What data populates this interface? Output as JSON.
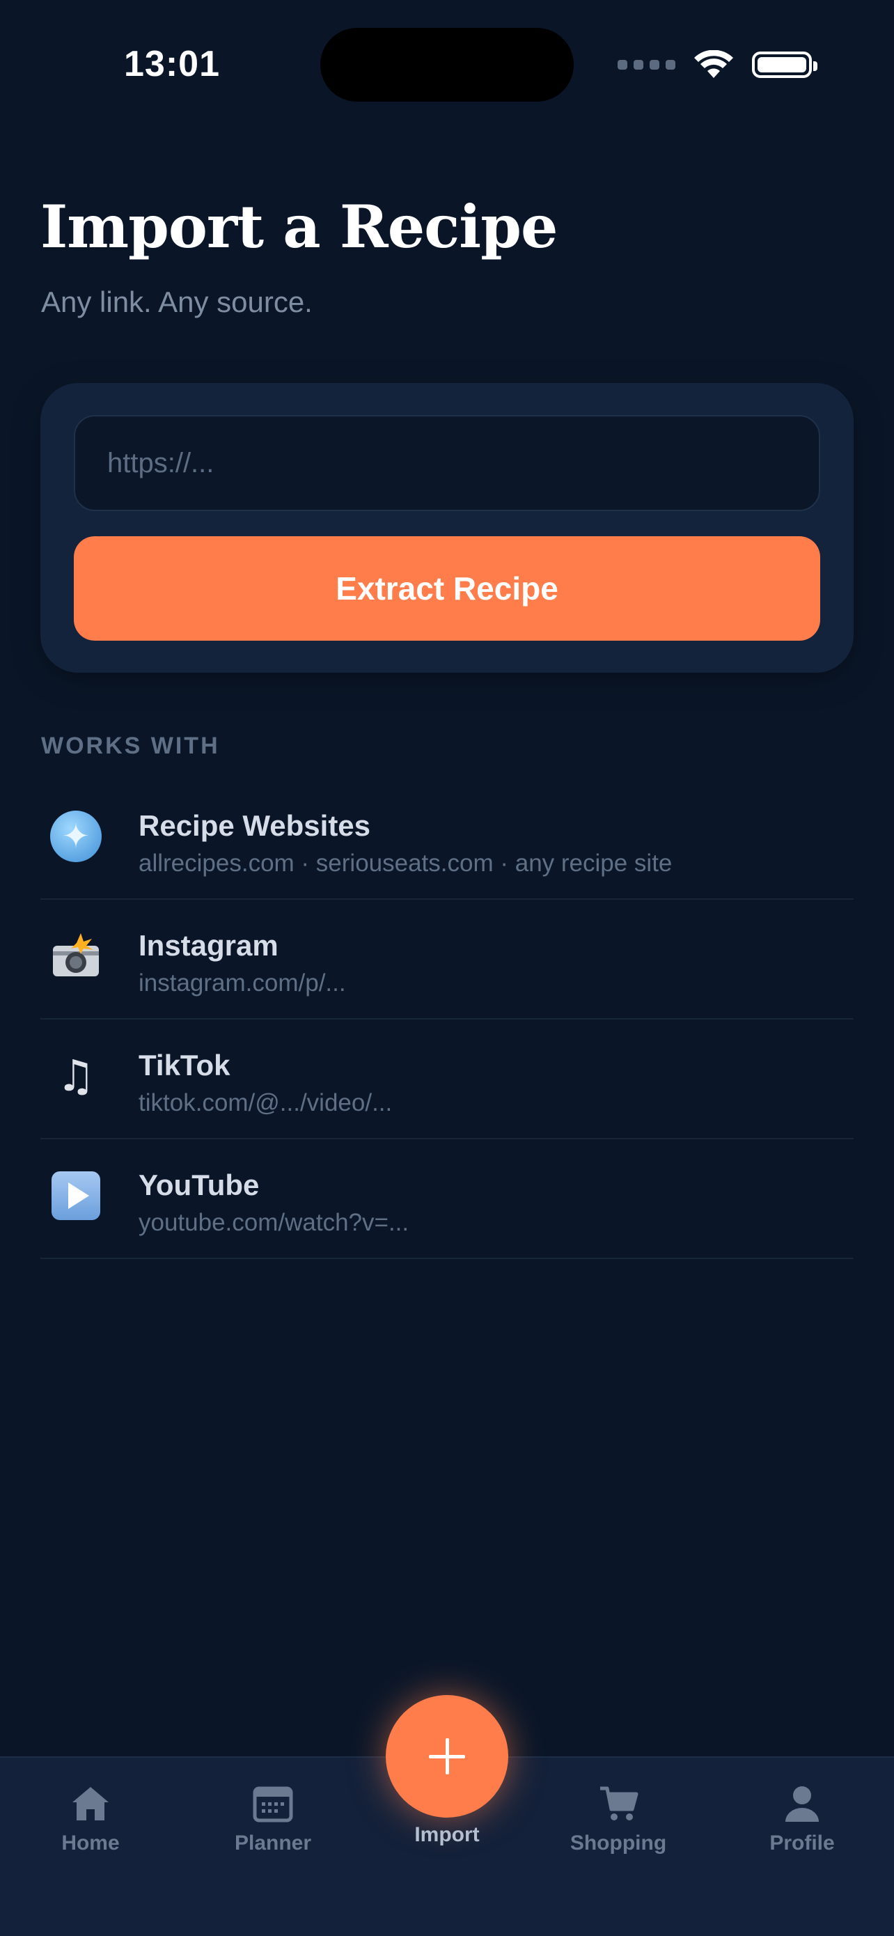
{
  "status_bar": {
    "time": "13:01"
  },
  "header": {
    "title": "Import a Recipe",
    "subtitle": "Any link. Any source."
  },
  "import_card": {
    "url_placeholder": "https://...",
    "url_value": "",
    "extract_label": "Extract Recipe"
  },
  "works_with": {
    "label": "WORKS WITH",
    "sources": [
      {
        "icon": "globe-icon",
        "name": "Recipe Websites",
        "desc": "allrecipes.com · seriouseats.com · any recipe site"
      },
      {
        "icon": "camera-flash-icon",
        "name": "Instagram",
        "desc": "instagram.com/p/..."
      },
      {
        "icon": "music-note-icon",
        "name": "TikTok",
        "desc": "tiktok.com/@.../video/..."
      },
      {
        "icon": "play-button-icon",
        "name": "YouTube",
        "desc": "youtube.com/watch?v=..."
      }
    ]
  },
  "tab_bar": {
    "home": "Home",
    "planner": "Planner",
    "import": "Import",
    "shopping": "Shopping",
    "profile": "Profile"
  },
  "colors": {
    "background": "#0a1628",
    "card": "#13233b",
    "accent": "#ff7d4b",
    "muted": "#5f6f86"
  }
}
